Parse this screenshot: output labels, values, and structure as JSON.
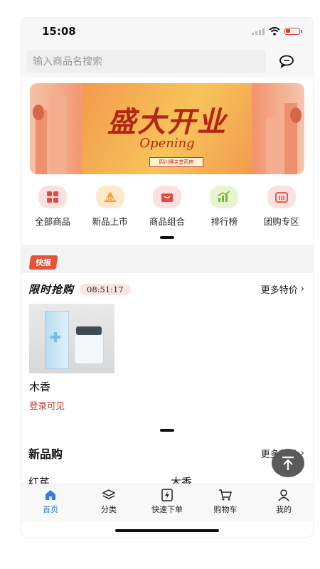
{
  "status": {
    "time": "15:08"
  },
  "search": {
    "placeholder": "输入商品名搜索"
  },
  "banner": {
    "title": "盛大开业",
    "subtitle": "Opening",
    "tag": "四川博主堂药房"
  },
  "categories": [
    {
      "label": "全部商品",
      "icon": "grid-icon",
      "bg": "#fbe0df",
      "color": "#e34a40"
    },
    {
      "label": "新品上市",
      "icon": "new-product-icon",
      "bg": "#fdeacb",
      "color": "#f0a23a"
    },
    {
      "label": "商品组合",
      "icon": "bag-icon",
      "bg": "#fbe0df",
      "color": "#e34a40"
    },
    {
      "label": "排行榜",
      "icon": "chart-icon",
      "bg": "#e7f4cf",
      "color": "#79b33c"
    },
    {
      "label": "团购专区",
      "icon": "group-buy-icon",
      "bg": "#fbe0df",
      "color": "#e34a40"
    }
  ],
  "news": {
    "badge": "快报"
  },
  "flash_sale": {
    "title": "限时抢购",
    "countdown": "08:51:17",
    "more": "更多特价",
    "products": [
      {
        "name": "木香",
        "price_note": "登录可见"
      }
    ]
  },
  "new_goods": {
    "title": "新品购",
    "more": "更多新品",
    "items": [
      {
        "name": "红芪"
      },
      {
        "name": "木香"
      }
    ]
  },
  "tabbar": {
    "items": [
      {
        "label": "首页",
        "icon": "home-icon",
        "active": true
      },
      {
        "label": "分类",
        "icon": "layers-icon",
        "active": false
      },
      {
        "label": "快速下单",
        "icon": "quick-order-icon",
        "active": false
      },
      {
        "label": "购物车",
        "icon": "cart-icon",
        "active": false
      },
      {
        "label": "我的",
        "icon": "user-icon",
        "active": false
      }
    ]
  },
  "colors": {
    "accent": "#3b7ad9",
    "sale_red": "#c0392b",
    "badge_red": "#e8503a"
  }
}
